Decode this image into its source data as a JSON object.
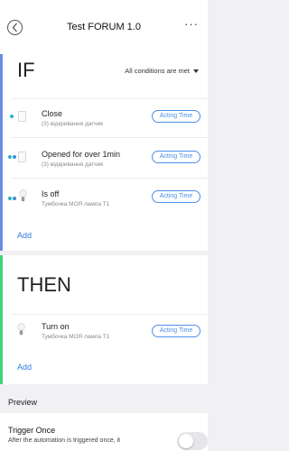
{
  "header": {
    "title": "Test FORUM 1.0",
    "back_icon": "chevron-left-icon",
    "more_label": "···"
  },
  "if_section": {
    "label": "IF",
    "condition_mode": "All conditions are met",
    "items": [
      {
        "title": "Close",
        "subtitle": "(3) відкривання датчик",
        "action": "Acting Time",
        "icon": "door-sensor-icon"
      },
      {
        "title": "Opened for over 1min",
        "subtitle": "(3) відкривання датчик",
        "action": "Acting Time",
        "icon": "door-sensor-icon"
      },
      {
        "title": "Is off",
        "subtitle": "Тумбочка МОЯ лампа  T1",
        "action": "Acting Time",
        "icon": "bulb-icon"
      }
    ],
    "add_label": "Add"
  },
  "then_section": {
    "label": "THEN",
    "items": [
      {
        "title": "Turn on",
        "subtitle": "Тумбочка МОЯ лампа  T1",
        "action": "Acting Time",
        "icon": "bulb-icon"
      }
    ],
    "add_label": "Add"
  },
  "preview": {
    "label": "Preview"
  },
  "trigger_once": {
    "title": "Trigger Once",
    "description": "After the automation is triggered once, it",
    "enabled": false
  },
  "colors": {
    "accent": "#4a90e2",
    "if_bar": "#6d8be0",
    "then_bar": "#3ed57b",
    "status_dot": "#28b3c8"
  }
}
